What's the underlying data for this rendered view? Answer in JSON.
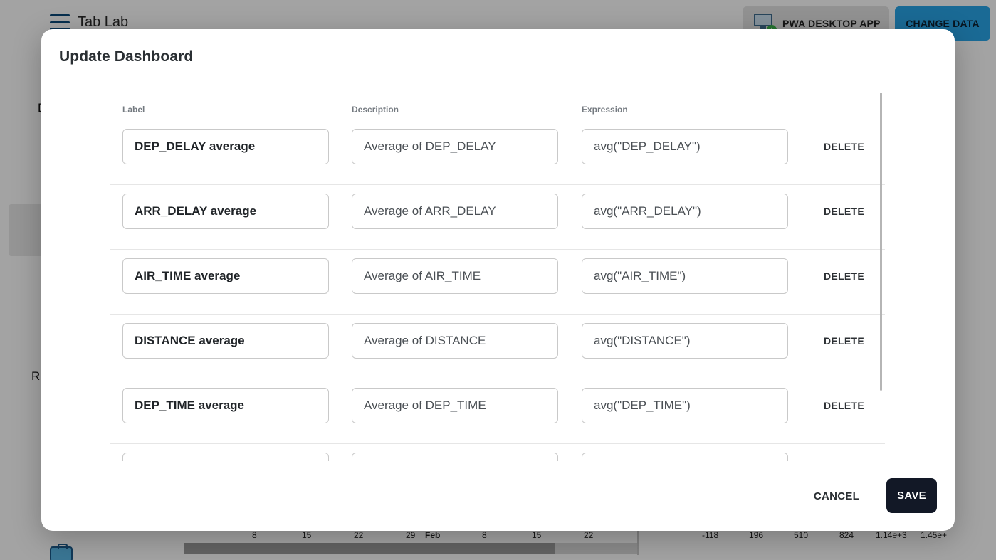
{
  "app": {
    "title": "Tab Lab",
    "pwa_button": "PWA DESKTOP APP",
    "change_data_button": "CHANGE DATA",
    "sidebar_fragments": [
      "D",
      "Re"
    ],
    "axis_left_ticks": [
      "8",
      "15",
      "22",
      "29",
      "Feb",
      "8",
      "15",
      "22"
    ],
    "axis_right_ticks": [
      "-118",
      "196",
      "510",
      "824",
      "1.14e+3",
      "1.45e+"
    ]
  },
  "modal": {
    "title": "Update Dashboard",
    "columns": {
      "label": "Label",
      "description": "Description",
      "expression": "Expression"
    },
    "delete_label": "DELETE",
    "rows": [
      {
        "label": "DEP_DELAY average",
        "description": "Average of DEP_DELAY",
        "expression": "avg(\"DEP_DELAY\")"
      },
      {
        "label": "ARR_DELAY average",
        "description": "Average of ARR_DELAY",
        "expression": "avg(\"ARR_DELAY\")"
      },
      {
        "label": "AIR_TIME average",
        "description": "Average of AIR_TIME",
        "expression": "avg(\"AIR_TIME\")"
      },
      {
        "label": "DISTANCE average",
        "description": "Average of DISTANCE",
        "expression": "avg(\"DISTANCE\")"
      },
      {
        "label": "DEP_TIME average",
        "description": "Average of DEP_TIME",
        "expression": "avg(\"DEP_TIME\")"
      },
      {
        "label": "",
        "description": "",
        "expression": ""
      }
    ],
    "cancel_label": "CANCEL",
    "save_label": "SAVE"
  }
}
